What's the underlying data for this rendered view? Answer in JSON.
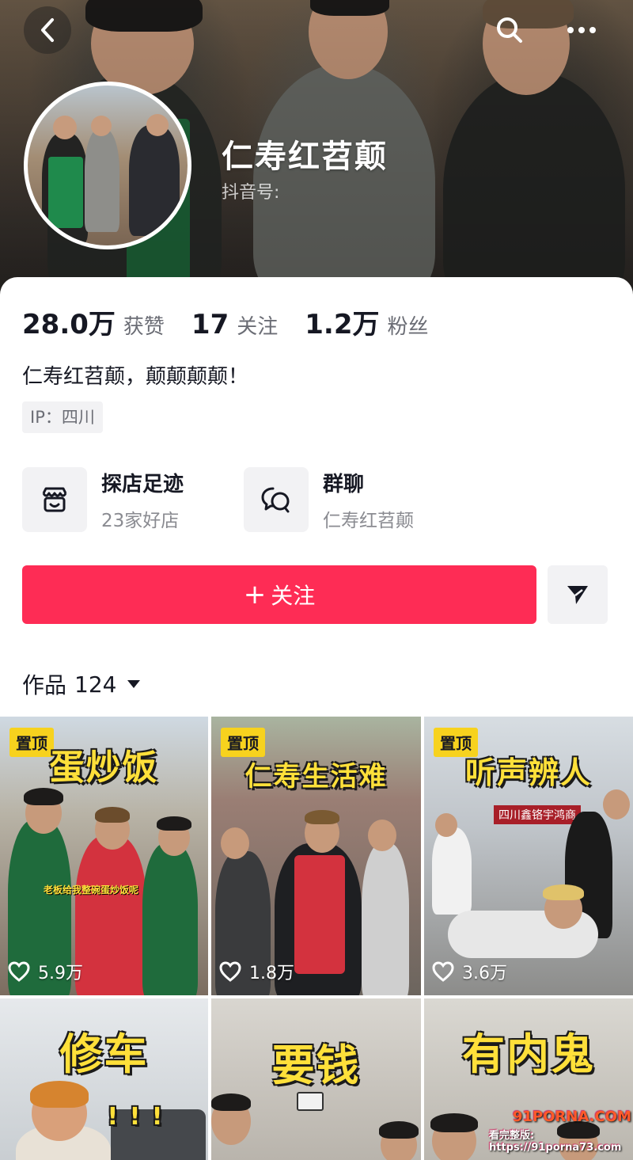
{
  "header": {
    "nickname": "仁寿红苕颠",
    "douyin_id_label": "抖音号:",
    "back_icon": "back-icon",
    "search_icon": "search-icon",
    "more_icon": "more-icon"
  },
  "stats": [
    {
      "value": "28.0万",
      "label": "获赞"
    },
    {
      "value": "17",
      "label": "关注"
    },
    {
      "value": "1.2万",
      "label": "粉丝"
    }
  ],
  "bio": "仁寿红苕颠，颠颠颠颠！",
  "ip_tag": "IP：四川",
  "services": [
    {
      "title": "探店足迹",
      "subtitle": "23家好店",
      "icon": "store-icon"
    },
    {
      "title": "群聊",
      "subtitle": "仁寿红苕颠",
      "icon": "group-chat-icon"
    }
  ],
  "actions": {
    "follow_plus": "+",
    "follow_label": "关注",
    "share_icon": "send-icon"
  },
  "works": {
    "label": "作品",
    "count": "124"
  },
  "videos": [
    {
      "pinned": "置顶",
      "title": "蛋炒饭",
      "caption": "老板给我整碗蛋炒饭呢",
      "likes": "5.9万"
    },
    {
      "pinned": "置顶",
      "title": "仁寿生活难",
      "likes": "1.8万"
    },
    {
      "pinned": "置顶",
      "title": "听声辨人",
      "sign": "四川鑫铬宇鸿商",
      "likes": "3.6万"
    },
    {
      "title": "修车",
      "exclaim": "! ! !"
    },
    {
      "title": "要钱"
    },
    {
      "title": "有内鬼"
    }
  ],
  "watermark": {
    "line1": "91PORNA.COM",
    "line2": "看完整版: https://91porna73.com"
  },
  "colors": {
    "accent": "#fe2c55",
    "pin_badge": "#f7d21e",
    "title_yellow": "#ffe03a"
  }
}
